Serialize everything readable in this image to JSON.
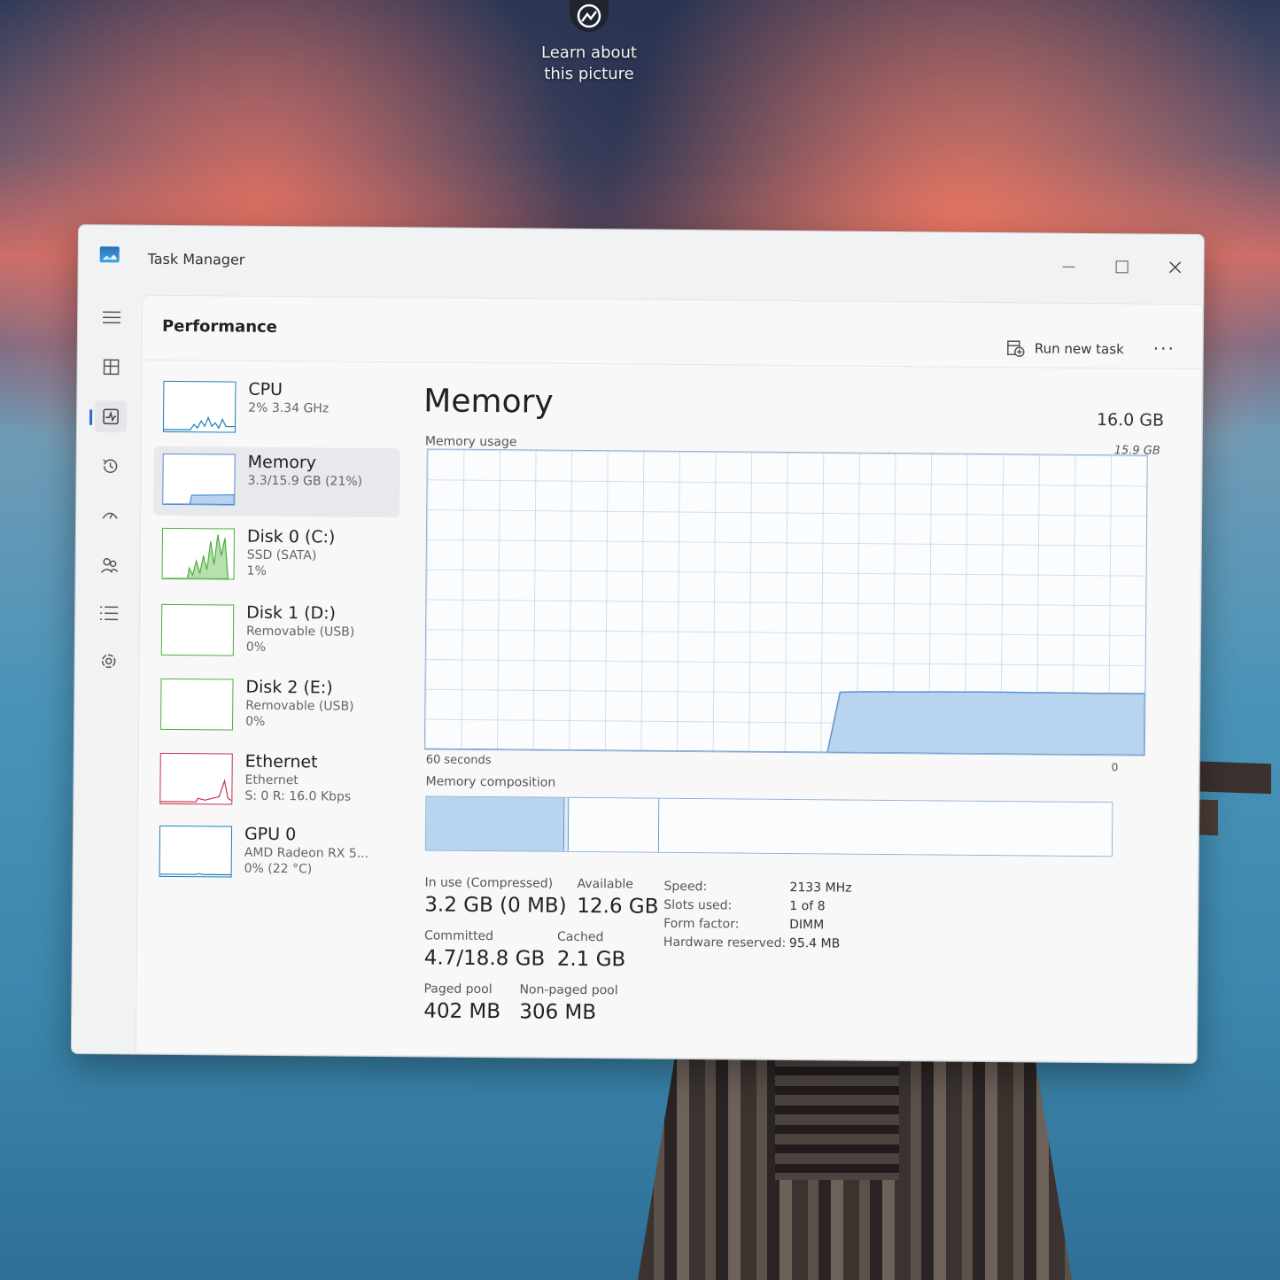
{
  "desktop": {
    "hint_line1": "Learn about",
    "hint_line2": "this picture"
  },
  "window": {
    "title": "Task Manager"
  },
  "header": {
    "title": "Performance",
    "run_new_task": "Run new task",
    "more": "..."
  },
  "side_items": [
    {
      "name": "CPU",
      "sub1": "2% 3.34 GHz",
      "sub2": "",
      "graph_color": "#1a7fb8"
    },
    {
      "name": "Memory",
      "sub1": "3.3/15.9 GB (21%)",
      "sub2": "",
      "graph_color": "#4b8bd6"
    },
    {
      "name": "Disk 0 (C:)",
      "sub1": "SSD (SATA)",
      "sub2": "1%",
      "graph_color": "#4caf3a"
    },
    {
      "name": "Disk 1 (D:)",
      "sub1": "Removable (USB)",
      "sub2": "0%",
      "graph_color": "#4caf3a"
    },
    {
      "name": "Disk 2 (E:)",
      "sub1": "Removable (USB)",
      "sub2": "0%",
      "graph_color": "#4caf3a"
    },
    {
      "name": "Ethernet",
      "sub1": "Ethernet",
      "sub2": "S: 0 R: 16.0 Kbps",
      "graph_color": "#c4314b"
    },
    {
      "name": "GPU 0",
      "sub1": "AMD Radeon RX 5...",
      "sub2": "0% (22 °C)",
      "graph_color": "#1a7fb8"
    }
  ],
  "memory": {
    "title": "Memory",
    "total": "16.0 GB",
    "usage_label": "Memory usage",
    "max_label": "15.9 GB",
    "time_label": "60 seconds",
    "zero_label": "0",
    "composition_label": "Memory composition",
    "composition": {
      "in_use_gb": 3.2,
      "modified_gb": 0.1,
      "standby_gb": 2.1,
      "free_gb": 10.5
    }
  },
  "stats": {
    "in_use_label": "In use (Compressed)",
    "in_use_value": "3.2 GB (0 MB)",
    "available_label": "Available",
    "available_value": "12.6 GB",
    "committed_label": "Committed",
    "committed_value": "4.7/18.8 GB",
    "cached_label": "Cached",
    "cached_value": "2.1 GB",
    "paged_label": "Paged pool",
    "paged_value": "402 MB",
    "nonpaged_label": "Non-paged pool",
    "nonpaged_value": "306 MB"
  },
  "hardware": [
    {
      "key": "Speed:",
      "value": "2133 MHz"
    },
    {
      "key": "Slots used:",
      "value": "1 of 8"
    },
    {
      "key": "Form factor:",
      "value": "DIMM"
    },
    {
      "key": "Hardware reserved:",
      "value": "95.4 MB"
    }
  ],
  "usage_history_gb": [
    0,
    0,
    0,
    0,
    0,
    0,
    0,
    0,
    0,
    0,
    0,
    0,
    0,
    0,
    0,
    0,
    0,
    0,
    0,
    0,
    0,
    0,
    0,
    0,
    0,
    0,
    0,
    0,
    0,
    0,
    0,
    0,
    0,
    0,
    3.2,
    3.22,
    3.24,
    3.24,
    3.25,
    3.24,
    3.25,
    3.26,
    3.27,
    3.27,
    3.27,
    3.28,
    3.28,
    3.28,
    3.28,
    3.27,
    3.27,
    3.28,
    3.27,
    3.27,
    3.27,
    3.26,
    3.27,
    3.27,
    3.27,
    3.27
  ],
  "colors": {
    "accent": "#2a6cc4",
    "memory_fill": "#b8d4ef",
    "memory_line": "#5f94cf"
  }
}
